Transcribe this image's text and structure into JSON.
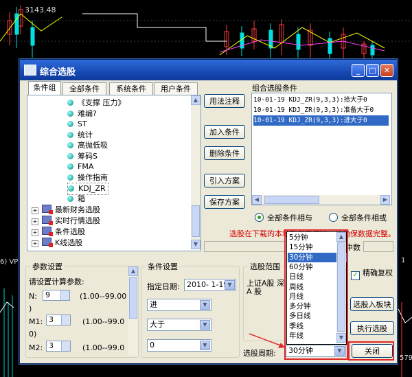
{
  "background": {
    "top_price": "3143.48",
    "left_label": "6) VP",
    "right_top": "1",
    "right_bottom": "579"
  },
  "window": {
    "title": "综合选股"
  },
  "tabs": [
    "条件组",
    "全部条件",
    "系统条件",
    "用户条件"
  ],
  "tree": {
    "leaf_items": [
      "《支撑 压力》",
      "难编?",
      "ST",
      "统计",
      "高抛低吸",
      "筹码S",
      "FMA",
      "操作指南",
      "KDJ_ZR",
      "箱"
    ],
    "group_items": [
      "最新财务选股",
      "实时行情选股",
      "条件选股",
      "K线选股"
    ]
  },
  "middle_buttons": [
    "用法注释",
    "加入条件",
    "删除条件",
    "引入方案",
    "保存方案"
  ],
  "combined": {
    "label": "组合选股条件",
    "rows": [
      "10-01-19 KDJ_ZR(9,3,3):拾大于0",
      "10-01-19 KDJ_ZR(9,3,3):准备大于0",
      "10-01-19 KDJ_ZR(9,3,3):进大于0"
    ],
    "selected_index": 2
  },
  "logic": {
    "and_label": "全部条件相与",
    "or_label": "全部条件相或"
  },
  "warning": "选股在下载的本地数据中进行，请确保数据完整。",
  "middle_right_label": "中数",
  "params": {
    "title": "参数设置",
    "prompt": "请设置计算参数:",
    "n_label": "N:",
    "n_value": "9",
    "n_range": "(1.00--99.00",
    "n_close": ")",
    "m1_label": "M1:",
    "m1_value": "3",
    "m1_range": "(1.00--99.0",
    "m1_close": "0)",
    "m2_label": "M2:",
    "m2_value": "3",
    "m2_range": "(1.00--99.0"
  },
  "conditions": {
    "title": "条件设置",
    "date_label": "指定日期:",
    "date_value": "2010- 1-19",
    "field1": "进",
    "field2": "大于",
    "field3": "0"
  },
  "range": {
    "title": "选股范围",
    "line1": "上证A股 深",
    "line2": "A 股"
  },
  "accurate_restore": "精确复权",
  "period": {
    "label": "选股周期:",
    "value": "30分钟",
    "options": [
      "5分钟",
      "15分钟",
      "30分钟",
      "60分钟",
      "日线",
      "周线",
      "月线",
      "多分钟",
      "多日线",
      "季线",
      "年线"
    ],
    "selected_index": 2
  },
  "action_buttons": {
    "into_block": "选股入板块",
    "execute": "执行选股",
    "close": "关闭"
  }
}
